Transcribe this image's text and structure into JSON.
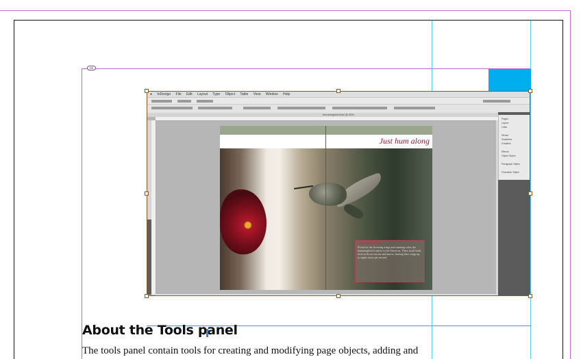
{
  "document": {
    "heading": "About the Tools panel",
    "body_line": "The tools panel contain tools for creating and modifying page objects, adding and"
  },
  "placed_image": {
    "menu_items": [
      "InDesign",
      "File",
      "Edit",
      "Layout",
      "Type",
      "Object",
      "Table",
      "View",
      "Window",
      "Help"
    ],
    "tab_label": "hummingbird.indd @ 50%",
    "spread_title": "Just hum along",
    "caption_heading": "Hummingbirds",
    "caption_text": "Prized for the hovering wings and stunning color, the hummingbird is native to the Americas. These small birds feed on flower nectar and insects, beating their wings up to eighty times per second.",
    "dock_items": [
      "Pages",
      "Layers",
      "Links",
      "Stroke",
      "Swatches",
      "Gradient",
      "Effects",
      "Object Styles",
      "Paragraph Styles",
      "Character Styles"
    ]
  },
  "colors": {
    "guide_cyan": "#4fd0e6",
    "margin_magenta": "#b56ad0",
    "frame_accent": "#00aeef",
    "text_cursor": "#3b7ee8"
  }
}
